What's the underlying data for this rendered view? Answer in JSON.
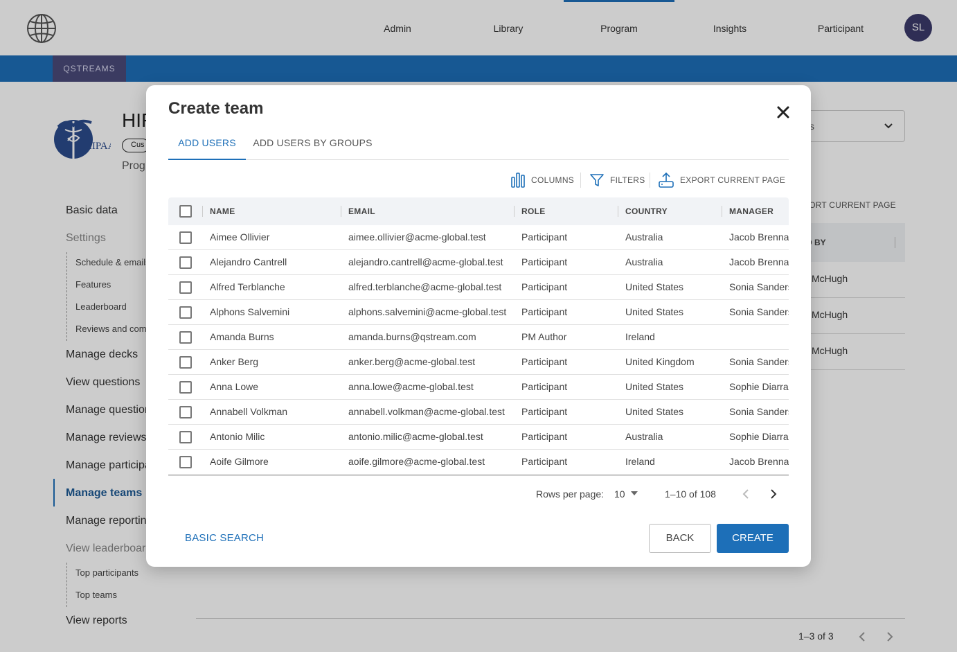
{
  "topnav": {
    "items": [
      "Admin",
      "Library",
      "Program",
      "Insights",
      "Participant"
    ],
    "avatar_initials": "SL",
    "accent_color": "#1d6fb8"
  },
  "bluebar": {
    "tag": "QSTREAMS"
  },
  "program": {
    "title": "HIF",
    "badge": "Cus",
    "subtitle": "Prog"
  },
  "sidebar": {
    "basic_data": "Basic data",
    "settings": "Settings",
    "settings_items": [
      "Schedule & emails",
      "Features",
      "Leaderboard",
      "Reviews and comments"
    ],
    "manage_decks": "Manage decks",
    "view_questions": "View questions",
    "manage_questions": "Manage questions",
    "manage_reviews": "Manage reviews",
    "manage_participants": "Manage participants",
    "manage_teams": "Manage teams",
    "manage_reporting": "Manage reporting",
    "view_leaderboards": "View leaderboards",
    "leaderboard_items": [
      "Top participants",
      "Top teams"
    ],
    "view_reports": "View reports"
  },
  "background_table": {
    "select_text": "s",
    "export_label": "PORT CURRENT PAGE",
    "column_header": "D BY",
    "rows": [
      "McHugh",
      "McHugh",
      "McHugh"
    ],
    "pager_range": "1–3 of 3"
  },
  "modal": {
    "title": "Create team",
    "tabs": [
      {
        "label": "ADD USERS",
        "active": true
      },
      {
        "label": "ADD USERS BY GROUPS",
        "active": false
      }
    ],
    "toolbar": {
      "columns_label": "COLUMNS",
      "filters_label": "FILTERS",
      "export_label": "EXPORT CURRENT PAGE"
    },
    "table": {
      "columns": [
        "NAME",
        "EMAIL",
        "ROLE",
        "COUNTRY",
        "MANAGER"
      ],
      "rows": [
        {
          "name": "Aimee Ollivier",
          "email": "aimee.ollivier@acme-global.test",
          "role": "Participant",
          "country": "Australia",
          "manager": "Jacob Brennan"
        },
        {
          "name": "Alejandro Cantrell",
          "email": "alejandro.cantrell@acme-global.test",
          "role": "Participant",
          "country": "Australia",
          "manager": "Jacob Brennan"
        },
        {
          "name": "Alfred Terblanche",
          "email": "alfred.terblanche@acme-global.test",
          "role": "Participant",
          "country": "United States",
          "manager": "Sonia Sanders"
        },
        {
          "name": "Alphons Salvemini",
          "email": "alphons.salvemini@acme-global.test",
          "role": "Participant",
          "country": "United States",
          "manager": "Sonia Sanders"
        },
        {
          "name": "Amanda Burns",
          "email": "amanda.burns@qstream.com",
          "role": "PM Author",
          "country": "Ireland",
          "manager": ""
        },
        {
          "name": "Anker Berg",
          "email": "anker.berg@acme-global.test",
          "role": "Participant",
          "country": "United Kingdom",
          "manager": "Sonia Sanders"
        },
        {
          "name": "Anna Lowe",
          "email": "anna.lowe@acme-global.test",
          "role": "Participant",
          "country": "United States",
          "manager": "Sophie Diarra"
        },
        {
          "name": "Annabell Volkman",
          "email": "annabell.volkman@acme-global.test",
          "role": "Participant",
          "country": "United States",
          "manager": "Sonia Sanders"
        },
        {
          "name": "Antonio Milic",
          "email": "antonio.milic@acme-global.test",
          "role": "Participant",
          "country": "Australia",
          "manager": "Sophie Diarra"
        },
        {
          "name": "Aoife Gilmore",
          "email": "aoife.gilmore@acme-global.test",
          "role": "Participant",
          "country": "Ireland",
          "manager": "Jacob Brennan"
        }
      ]
    },
    "pagination": {
      "rows_per_page_label": "Rows per page:",
      "rows_per_page_value": "10",
      "range": "1–10 of 108"
    },
    "footer": {
      "basic_search_label": "BASIC SEARCH",
      "back_label": "BACK",
      "create_label": "CREATE"
    }
  }
}
